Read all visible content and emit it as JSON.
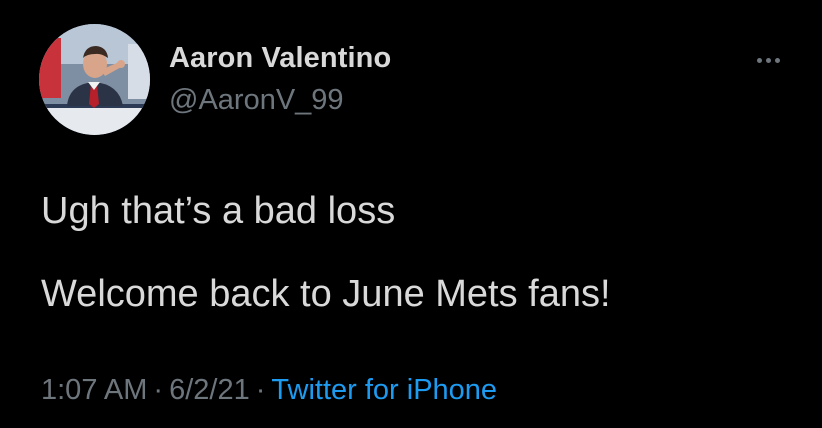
{
  "tweet": {
    "author": {
      "display_name": "Aaron Valentino",
      "handle": "@AaronV_99"
    },
    "lines": [
      "Ugh that’s a bad loss",
      "Welcome back to June Mets fans!"
    ],
    "meta": {
      "time": "1:07 AM",
      "separator": "·",
      "date": "6/2/21",
      "source": "Twitter for iPhone"
    }
  },
  "icons": {
    "more": "more-horizontal-icon"
  },
  "colors": {
    "background": "#000000",
    "text": "#d9d9d9",
    "secondary": "#6e767d",
    "link": "#1d9bf0"
  }
}
